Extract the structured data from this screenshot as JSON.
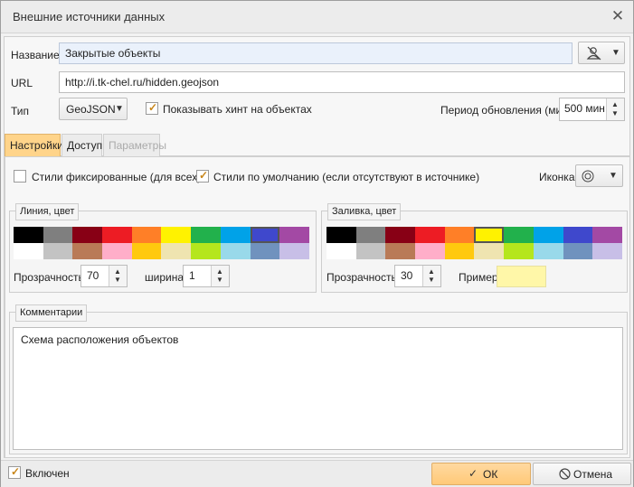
{
  "window": {
    "title": "Внешние источники данных"
  },
  "fields": {
    "name_label": "Название",
    "name_value": "Закрытые объекты",
    "url_label": "URL",
    "url_value": "http://i.tk-chel.ru/hidden.geojson",
    "type_label": "Тип",
    "type_value": "GeoJSON",
    "show_hint_label": "Показывать хинт на объектах",
    "show_hint_checked": true,
    "period_label": "Период обновления (мин)",
    "period_value": "500 мин"
  },
  "tabs": [
    {
      "label": "Настройки",
      "active": true
    },
    {
      "label": "Доступ",
      "active": false
    },
    {
      "label": "Параметры",
      "active": false,
      "disabled": true
    }
  ],
  "settings": {
    "fixed_styles_label": "Стили фиксированные (для всех)",
    "fixed_styles_checked": false,
    "default_styles_label": "Стили по умолчанию (если отсутствуют в источнике)",
    "default_styles_checked": true,
    "icon_label": "Иконка",
    "icon_name": "target-circle-icon"
  },
  "line_group": {
    "title": "Линия, цвет",
    "opacity_label": "Прозрачность",
    "opacity_value": "70",
    "width_label": "ширина",
    "width_value": "1",
    "selected_color": "#3f48cc"
  },
  "fill_group": {
    "title": "Заливка, цвет",
    "opacity_label": "Прозрачность",
    "opacity_value": "30",
    "sample_label": "Пример",
    "sample_color": "#fff7a8",
    "selected_color": "#fff200"
  },
  "palette": {
    "top": [
      "#000000",
      "#7f7f7f",
      "#880015",
      "#ed1c24",
      "#ff7f27",
      "#fff200",
      "#22b14c",
      "#00a2e8",
      "#3f48cc",
      "#a349a4"
    ],
    "bottom": [
      "#ffffff",
      "#c3c3c3",
      "#b97a57",
      "#ffaec9",
      "#ffc90e",
      "#efe4b0",
      "#b5e61d",
      "#99d9ea",
      "#7092be",
      "#c8bfe7"
    ]
  },
  "comments": {
    "title": "Комментарии",
    "text": "Схема расположения объектов"
  },
  "footer": {
    "enabled_label": "Включен",
    "enabled_checked": true,
    "ok_label": "ОК",
    "cancel_label": "Отмена"
  },
  "colors": {
    "accent": "#ffd48a",
    "ok_button": "#ffcf8a",
    "checkmark": "#c8861a"
  }
}
